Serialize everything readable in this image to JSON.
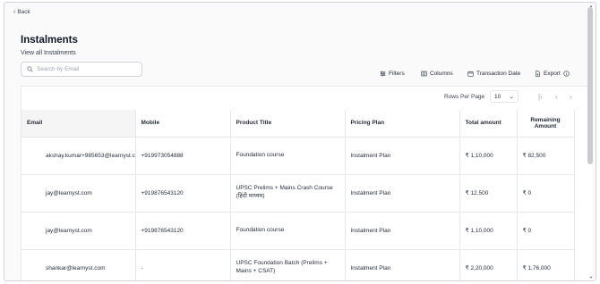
{
  "nav": {
    "back_label": "Back"
  },
  "page": {
    "title": "Instalments",
    "subtitle": "View all Instalments"
  },
  "search": {
    "placeholder": "Search by Email",
    "value": ""
  },
  "toolbar": {
    "filters": "Filters",
    "columns": "Columns",
    "transaction_date": "Transaction Date",
    "export": "Export"
  },
  "pagination": {
    "rows_per_page_label": "Rows Per Page",
    "rows_per_page_value": "10"
  },
  "table": {
    "headers": {
      "email": "Email",
      "mobile": "Mobile",
      "product": "Product Title",
      "plan": "Pricing Plan",
      "total": "Total amount",
      "remaining": "Remaining Amount"
    },
    "rows": [
      {
        "email": "akshay.kumar+985653@learnyst.c",
        "mobile": "+919973054888",
        "product": "Foundation course",
        "plan": "Instalment Plan",
        "total": "₹ 1,10,000",
        "remaining": "₹ 82,500"
      },
      {
        "email": "jay@learnyst.com",
        "mobile": "+919876543120",
        "product": "UPSC Prelims + Mains Crash Course (हिंदी माध्यम)",
        "plan": "Instalment Plan",
        "total": "₹ 12,500",
        "remaining": "₹ 0"
      },
      {
        "email": "jay@learnyst.com",
        "mobile": "+919876543120",
        "product": "Foundation course",
        "plan": "Instalment Plan",
        "total": "₹ 1,10,000",
        "remaining": "₹ 0"
      },
      {
        "email": "shankar@learnyst.com",
        "mobile": "-",
        "product": "UPSC Foundation Batch (Prelims + Mains + CSAT)",
        "plan": "Instalment Plan",
        "total": "₹ 2,20,000",
        "remaining": "₹ 1,76,000"
      }
    ]
  }
}
